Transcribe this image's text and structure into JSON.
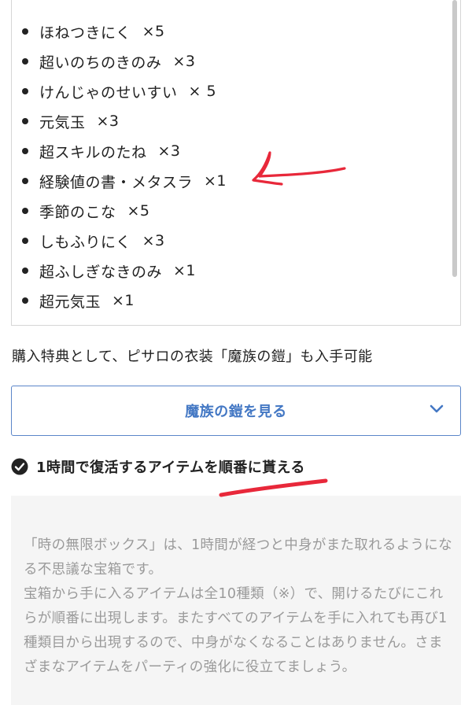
{
  "items": [
    {
      "name": "ほねつきにく",
      "qty": "×5"
    },
    {
      "name": "超いのちのきのみ",
      "qty": "×3"
    },
    {
      "name": "けんじゃのせいすい",
      "qty": "× 5"
    },
    {
      "name": "元気玉",
      "qty": "×3"
    },
    {
      "name": "超スキルのたね",
      "qty": "×3"
    },
    {
      "name": "経験値の書・メタスラ",
      "qty": "×1"
    },
    {
      "name": "季節のこな",
      "qty": "×5"
    },
    {
      "name": "しもふりにく",
      "qty": "×3"
    },
    {
      "name": "超ふしぎなきのみ",
      "qty": "×1"
    },
    {
      "name": "超元気玉",
      "qty": "×1"
    }
  ],
  "bonus_text": "購入特典として、ピサロの衣装「魔族の鎧」も入手可能",
  "toggle": {
    "label": "魔族の鎧を見る",
    "icon": "chevron-down-icon"
  },
  "section": {
    "icon": "check-circle-icon",
    "heading": "1時間で復活するアイテムを順番に貰える",
    "paragraphs": [
      "「時の無限ボックス」は、1時間が経つと中身がまた取れるようになる不思議な宝箱です。",
      "宝箱から手に入るアイテムは全10種類（※）で、開けるたびにこれらが順番に出現します。またすべてのアイテムを手に入れても再び1種類目から出現するので、中身がなくなることはありません。さまざまなアイテムをパーティの強化に役立てましょう。"
    ]
  },
  "colors": {
    "accent": "#4478c4",
    "annotation": "#e8283a",
    "desc_bg": "#f5f5f5",
    "desc_text": "#9a9a9a"
  }
}
